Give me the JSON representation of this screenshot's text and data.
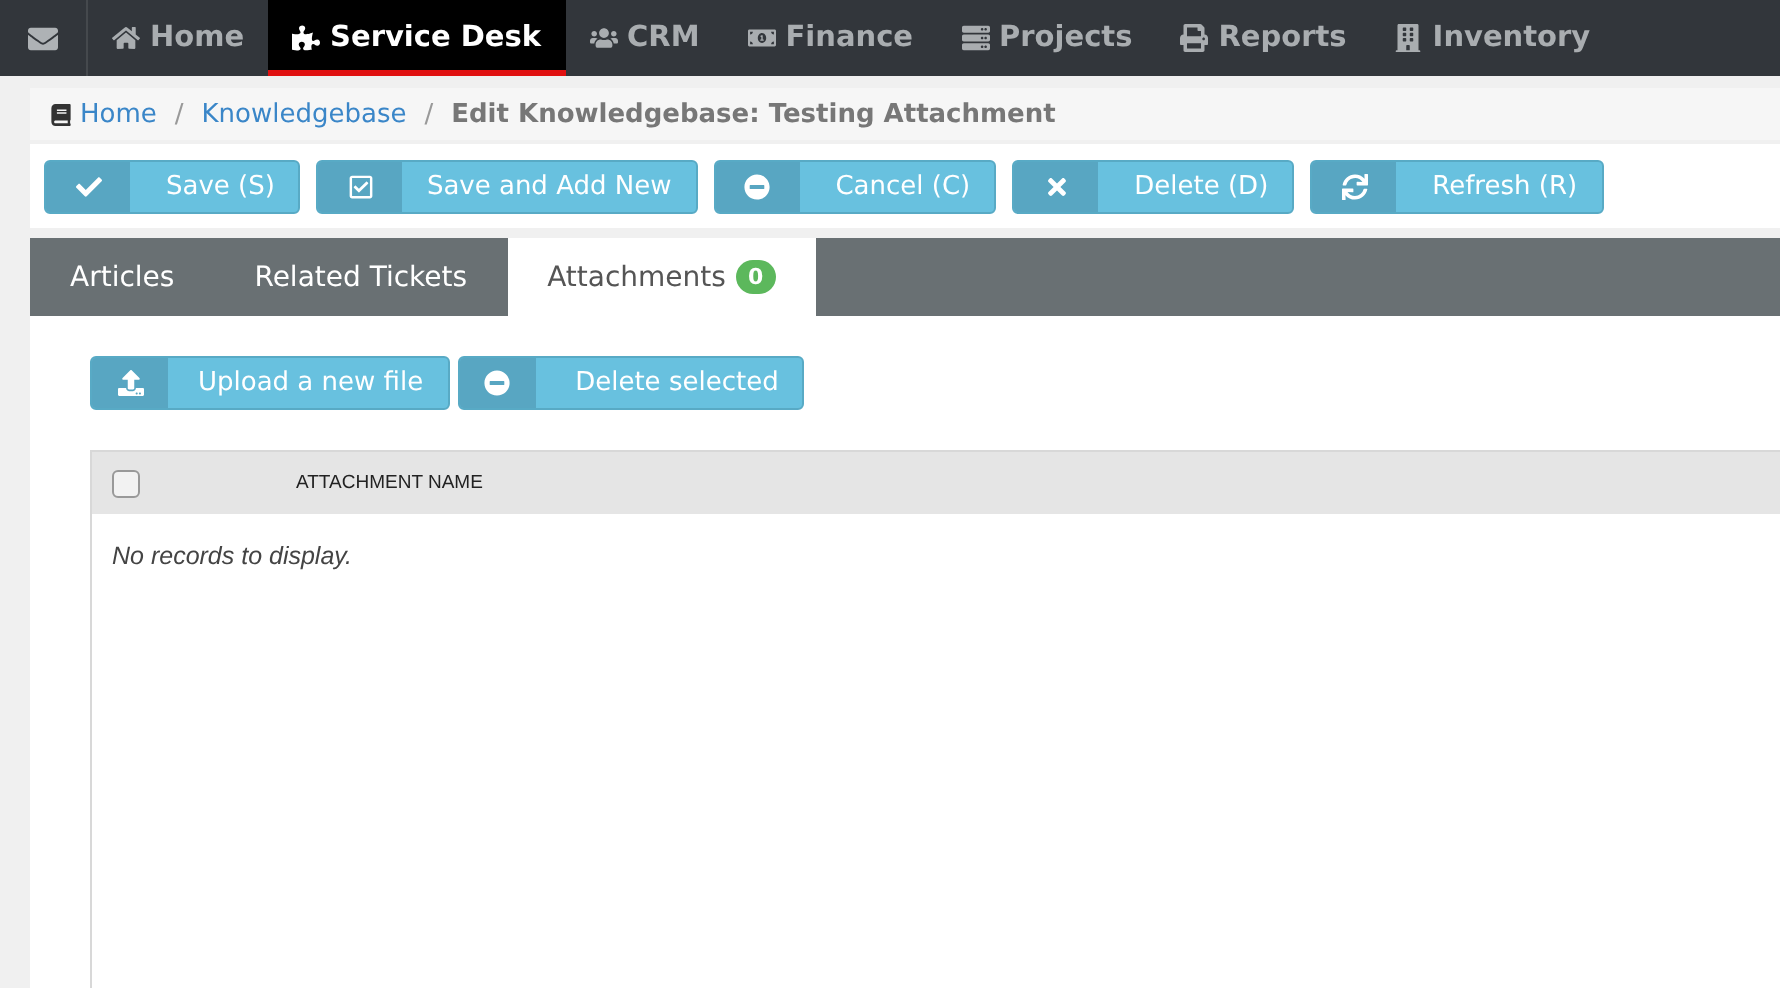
{
  "nav": {
    "items": [
      {
        "label": "Home",
        "selected": false
      },
      {
        "label": "Service Desk",
        "selected": true
      },
      {
        "label": "CRM",
        "selected": false
      },
      {
        "label": "Finance",
        "selected": false
      },
      {
        "label": "Projects",
        "selected": false
      },
      {
        "label": "Reports",
        "selected": false
      },
      {
        "label": "Inventory",
        "selected": false
      }
    ]
  },
  "breadcrumb": {
    "links": [
      "Home",
      "Knowledgebase"
    ],
    "separators": [
      "/",
      "/"
    ],
    "current": "Edit Knowledgebase: Testing Attachment"
  },
  "toolbar": [
    {
      "label": "Save (S)"
    },
    {
      "label": "Save and Add New"
    },
    {
      "label": "Cancel (C)"
    },
    {
      "label": "Delete (D)"
    },
    {
      "label": "Refresh (R)"
    }
  ],
  "tabs": [
    {
      "label": "Articles",
      "selected": false
    },
    {
      "label": "Related Tickets",
      "selected": false
    },
    {
      "label": "Attachments",
      "badge": "0",
      "selected": true
    }
  ],
  "attachments": {
    "actions": [
      {
        "label": "Upload a new file"
      },
      {
        "label": "Delete selected"
      }
    ],
    "table": {
      "select_all": {
        "checked": false
      },
      "columns": [
        "ATTACHMENT NAME"
      ],
      "empty_message": "No records to display."
    }
  }
}
